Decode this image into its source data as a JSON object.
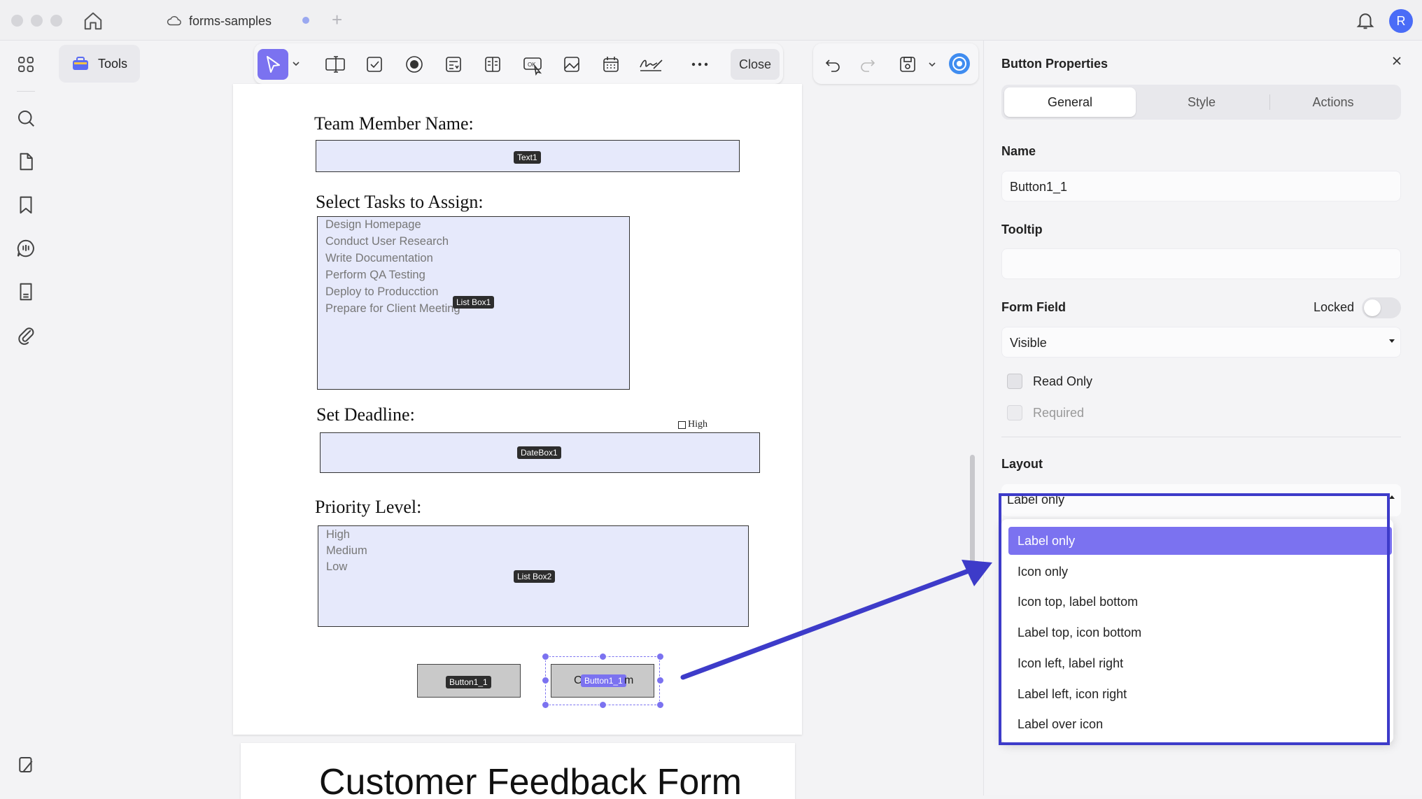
{
  "window": {
    "tab_title": "forms-samples",
    "avatar_initial": "R"
  },
  "tools": {
    "label": "Tools"
  },
  "toolbar": {
    "close_label": "Close"
  },
  "document": {
    "page1": {
      "label_team_member": "Team Member Name:",
      "text1_tag": "Text1",
      "label_tasks": "Select Tasks to Assign:",
      "tasks": [
        "Design Homepage",
        "Conduct User Research",
        "Write Documentation",
        "Perform QA Testing",
        "Deploy to Producction",
        "Prepare for Client Meeting"
      ],
      "listbox1_tag": "List Box1",
      "label_deadline": "Set Deadline:",
      "high_checkbox_label": "High",
      "datebox1_tag": "DateBox1",
      "label_priority": "Priority Level:",
      "priorities": [
        "High",
        "Medium",
        "Low"
      ],
      "listbox2_tag": "List Box2",
      "button_left_tag": "Button1_1",
      "button_right_text_start": "C",
      "button_right_text_end": "m",
      "button_right_tag": "Button1_1"
    },
    "page2": {
      "title": "Customer Feedback Form"
    }
  },
  "panel": {
    "title": "Button Properties",
    "tabs": [
      "General",
      "Style",
      "Actions"
    ],
    "active_tab": "General",
    "name_label": "Name",
    "name_value": "Button1_1",
    "tooltip_label": "Tooltip",
    "tooltip_value": "",
    "form_field_label": "Form Field",
    "locked_label": "Locked",
    "locked": false,
    "visibility_value": "Visible",
    "read_only_label": "Read Only",
    "required_label": "Required",
    "layout_label": "Layout",
    "layout_value": "Label only",
    "layout_options": [
      "Label only",
      "Icon only",
      "Icon top, label bottom",
      "Label top, icon bottom",
      "Icon left, label right",
      "Label left, icon right",
      "Label over icon"
    ],
    "selected_layout": "Label only"
  },
  "colors": {
    "accent": "#7b72f0",
    "highlight_box": "#3d3bc9",
    "field_fill": "#e6e9fb",
    "avatar": "#4a6cf7"
  }
}
